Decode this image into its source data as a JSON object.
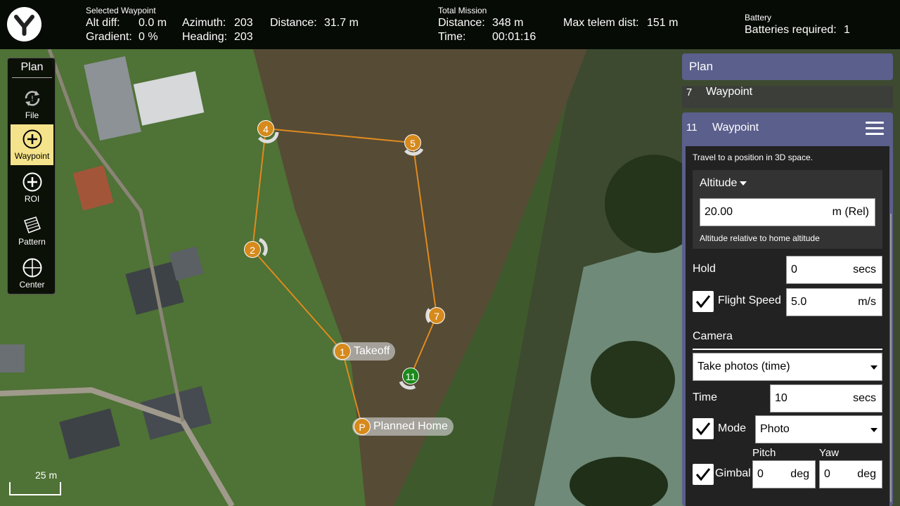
{
  "top_bar": {
    "selected_waypoint": {
      "section_title": "Selected Waypoint",
      "alt_diff_label": "Alt diff:",
      "alt_diff_value": "0.0 m",
      "gradient_label": "Gradient:",
      "gradient_value": "0 %",
      "azimuth_label": "Azimuth:",
      "azimuth_value": "203",
      "heading_label": "Heading:",
      "heading_value": "203",
      "distance_label": "Distance:",
      "distance_value": "31.7 m"
    },
    "total_mission": {
      "section_title": "Total Mission",
      "distance_label": "Distance:",
      "distance_value": "348 m",
      "time_label": "Time:",
      "time_value": "00:01:16",
      "max_telem_label": "Max telem dist:",
      "max_telem_value": "151 m"
    },
    "battery": {
      "section_title": "Battery",
      "required_label": "Batteries required:",
      "required_value": "1"
    }
  },
  "toolbar": {
    "title": "Plan",
    "tools": [
      {
        "label": "File",
        "icon": "file-sync-icon",
        "active": false
      },
      {
        "label": "Waypoint",
        "icon": "plus-circle-icon",
        "active": true
      },
      {
        "label": "ROI",
        "icon": "plus-circle-icon",
        "active": false
      },
      {
        "label": "Pattern",
        "icon": "grid-pattern-icon",
        "active": false
      },
      {
        "label": "Center",
        "icon": "crosshair-icon",
        "active": false
      }
    ]
  },
  "map": {
    "scale_label": "25 m",
    "waypoints": [
      {
        "id": "P",
        "label": "Planned Home"
      },
      {
        "id": "1",
        "label": "Takeoff"
      },
      {
        "id": "2",
        "label": ""
      },
      {
        "id": "4",
        "label": ""
      },
      {
        "id": "5",
        "label": ""
      },
      {
        "id": "7",
        "label": ""
      },
      {
        "id": "11",
        "label": ""
      }
    ],
    "colors": {
      "path": "#e08a1e",
      "waypoint": "#d68a1c",
      "current": "#1b8a1b"
    }
  },
  "panel": {
    "plan_title": "Plan",
    "wp7": {
      "num": "7",
      "label": "Waypoint"
    },
    "wp11": {
      "num": "11",
      "label": "Waypoint",
      "description": "Travel to a position in 3D space.",
      "altitude": {
        "title": "Altitude",
        "value": "20.00",
        "unit": "m (Rel)",
        "hint": "Altitude relative to home altitude"
      },
      "hold": {
        "label": "Hold",
        "value": "0",
        "unit": "secs"
      },
      "flight_speed": {
        "label": "Flight Speed",
        "checked": true,
        "value": "5.0",
        "unit": "m/s"
      },
      "camera": {
        "section_title": "Camera",
        "action": "Take photos (time)",
        "time": {
          "label": "Time",
          "value": "10",
          "unit": "secs"
        },
        "mode": {
          "label": "Mode",
          "checked": true,
          "value": "Photo"
        },
        "gimbal": {
          "label": "Gimbal",
          "checked": true,
          "pitch_label": "Pitch",
          "pitch_value": "0",
          "yaw_label": "Yaw",
          "yaw_value": "0",
          "unit": "deg"
        }
      }
    }
  }
}
